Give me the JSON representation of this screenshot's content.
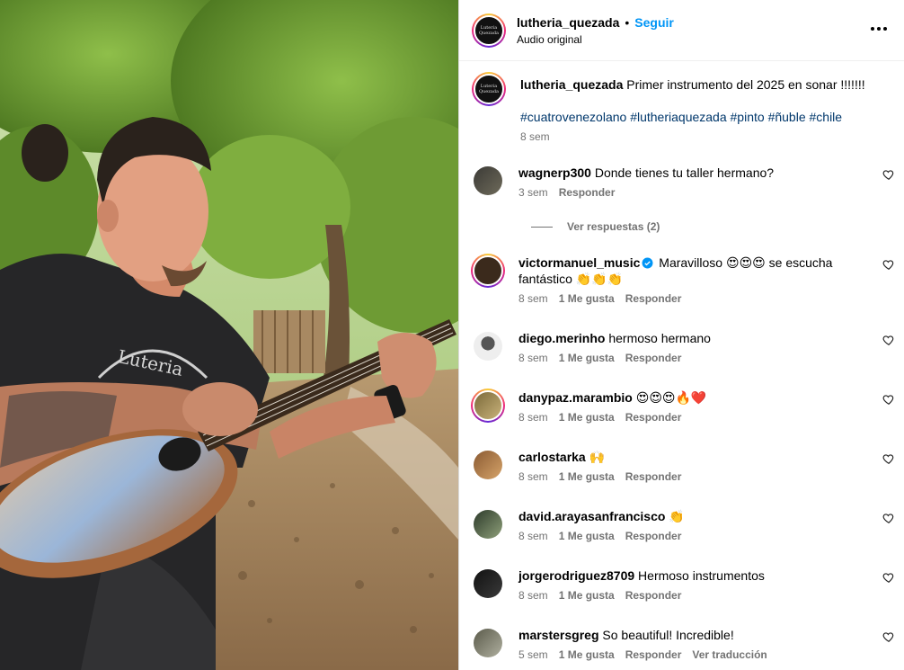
{
  "header": {
    "username": "lutheria_quezada",
    "dot": "•",
    "follow": "Seguir",
    "audio": "Audio original",
    "logo_text": "Luteria Quezada"
  },
  "caption": {
    "username": "lutheria_quezada",
    "text": "Primer instrumento del 2025 en sonar !!!!!!!",
    "hashtags": [
      "#cuatrovenezolano",
      "#lutheriaquezada",
      "#pinto",
      "#ñuble",
      "#chile"
    ],
    "time": "8 sem"
  },
  "view_replies": "Ver respuestas (2)",
  "comments": [
    {
      "username": "wagnerp300",
      "text": "Donde tienes tu taller hermano?",
      "time": "3 sem",
      "likes": "",
      "reply": "Responder",
      "translate": ""
    },
    {
      "username": "victormanuel_music",
      "text": "Maravilloso 😍😍😍 se escucha fantástico 👏👏👏",
      "time": "8 sem",
      "likes": "1 Me gusta",
      "reply": "Responder",
      "translate": "",
      "verified": true
    },
    {
      "username": "diego.merinho",
      "text": "hermoso hermano",
      "time": "8 sem",
      "likes": "1 Me gusta",
      "reply": "Responder",
      "translate": ""
    },
    {
      "username": "danypaz.marambio",
      "text": "😍😍😍🔥❤️",
      "time": "8 sem",
      "likes": "1 Me gusta",
      "reply": "Responder",
      "translate": ""
    },
    {
      "username": "carlostarka",
      "text": "🙌",
      "time": "8 sem",
      "likes": "1 Me gusta",
      "reply": "Responder",
      "translate": ""
    },
    {
      "username": "david.arayasanfrancisco",
      "text": "👏",
      "time": "8 sem",
      "likes": "1 Me gusta",
      "reply": "Responder",
      "translate": ""
    },
    {
      "username": "jorgerodriguez8709",
      "text": "Hermoso instrumentos",
      "time": "8 sem",
      "likes": "1 Me gusta",
      "reply": "Responder",
      "translate": ""
    },
    {
      "username": "marstersgreg",
      "text": "So beautiful! Incredible!",
      "time": "5 sem",
      "likes": "1 Me gusta",
      "reply": "Responder",
      "translate": "Ver traducción"
    }
  ],
  "colors": {
    "link_blue": "#0095f6",
    "hashtag_blue": "#00376b",
    "muted": "#737373",
    "verified_blue": "#0095f6"
  }
}
